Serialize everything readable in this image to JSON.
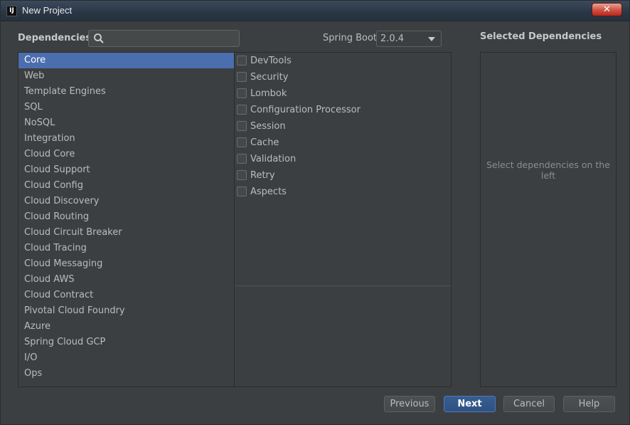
{
  "window": {
    "title": "New Project",
    "app_icon_text": "IJ",
    "close_label": "✕"
  },
  "header": {
    "dependencies_label": "Dependencies",
    "search": {
      "value": "",
      "placeholder": ""
    },
    "spring_boot_label": "Spring Boot",
    "spring_boot_version": "2.0.4",
    "selected_label": "Selected Dependencies"
  },
  "categories": [
    "Core",
    "Web",
    "Template Engines",
    "SQL",
    "NoSQL",
    "Integration",
    "Cloud Core",
    "Cloud Support",
    "Cloud Config",
    "Cloud Discovery",
    "Cloud Routing",
    "Cloud Circuit Breaker",
    "Cloud Tracing",
    "Cloud Messaging",
    "Cloud AWS",
    "Cloud Contract",
    "Pivotal Cloud Foundry",
    "Azure",
    "Spring Cloud GCP",
    "I/O",
    "Ops"
  ],
  "selected_category": "Core",
  "dependencies": [
    "DevTools",
    "Security",
    "Lombok",
    "Configuration Processor",
    "Session",
    "Cache",
    "Validation",
    "Retry",
    "Aspects"
  ],
  "selected_panel": {
    "empty_text": "Select dependencies on the left"
  },
  "buttons": {
    "previous": "Previous",
    "next": "Next",
    "cancel": "Cancel",
    "help": "Help"
  },
  "colors": {
    "background": "#3c3f41",
    "selection": "#4b6eaf",
    "primary_button": "#365880"
  },
  "icons": {
    "search": "search-icon",
    "dropdown": "chevron-down-icon",
    "close": "close-icon"
  }
}
